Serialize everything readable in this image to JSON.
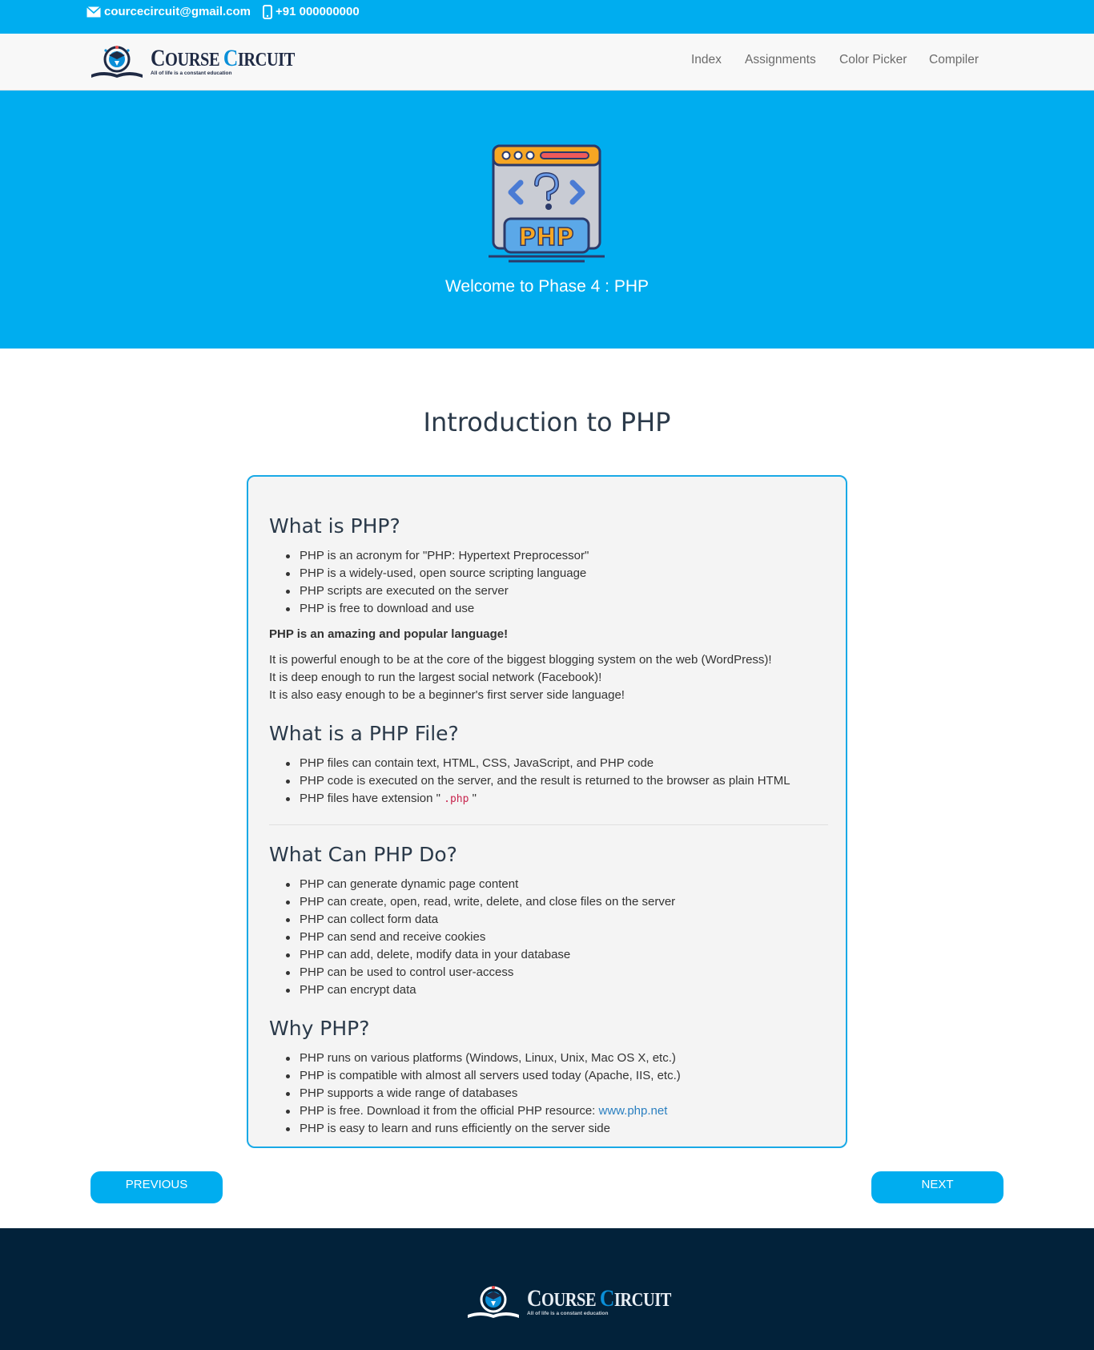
{
  "topbar": {
    "email": "courcecircuit@gmail.com",
    "phone": "+91 000000000",
    "email_icon": "envelope-icon",
    "phone_icon": "mobile-phone-icon"
  },
  "brand": {
    "word1_first": "C",
    "word1_rest": "OURSE",
    "word2_first": "C",
    "word2_rest": "IRCUIT",
    "tagline": "All of life is a constant education"
  },
  "nav": {
    "items": [
      {
        "label": "Index"
      },
      {
        "label": "Assignments"
      },
      {
        "label": "Color Picker"
      },
      {
        "label": "Compiler"
      }
    ]
  },
  "hero": {
    "icon": "php-code-window-icon",
    "icon_label": "PHP",
    "title": "Welcome to Phase 4 : PHP"
  },
  "main": {
    "title": "Introduction to PHP",
    "sections": {
      "what_is": {
        "heading": "What is PHP?",
        "items": [
          "PHP is an acronym for \"PHP: Hypertext Preprocessor\"",
          "PHP is a widely-used, open source scripting language",
          "PHP scripts are executed on the server",
          "PHP is free to download and use"
        ],
        "bold_note": "PHP is an amazing and popular language!",
        "paragraph_lines": [
          "It is powerful enough to be at the core of the biggest blogging system on the web (WordPress)!",
          "It is deep enough to run the largest social network (Facebook)!",
          "It is also easy enough to be a beginner's first server side language!"
        ]
      },
      "file": {
        "heading": "What is a PHP File?",
        "items": [
          "PHP files can contain text, HTML, CSS, JavaScript, and PHP code",
          "PHP code is executed on the server, and the result is returned to the browser as plain HTML"
        ],
        "extension_prefix": "PHP files have extension \"",
        "extension_code": ".php",
        "extension_suffix": " \""
      },
      "can_do": {
        "heading": "What Can PHP Do?",
        "items": [
          "PHP can generate dynamic page content",
          "PHP can create, open, read, write, delete, and close files on the server",
          "PHP can collect form data",
          "PHP can send and receive cookies",
          "PHP can add, delete, modify data in your database",
          "PHP can be used to control user-access",
          "PHP can encrypt data"
        ]
      },
      "why": {
        "heading": "Why PHP?",
        "items": [
          "PHP runs on various platforms (Windows, Linux, Unix, Mac OS X, etc.)",
          "PHP is compatible with almost all servers used today (Apache, IIS, etc.)",
          "PHP supports a wide range of databases"
        ],
        "free_prefix": "PHP is free. Download it from the official PHP resource: ",
        "free_link": "www.php.net",
        "last_item": "PHP is easy to learn and runs efficiently on the server side"
      }
    }
  },
  "buttons": {
    "previous": "PREVIOUS",
    "next": "NEXT"
  },
  "colors": {
    "accent": "#00adef",
    "footer": "#02223a",
    "link": "#2a7fc0",
    "code": "#c7254e"
  }
}
